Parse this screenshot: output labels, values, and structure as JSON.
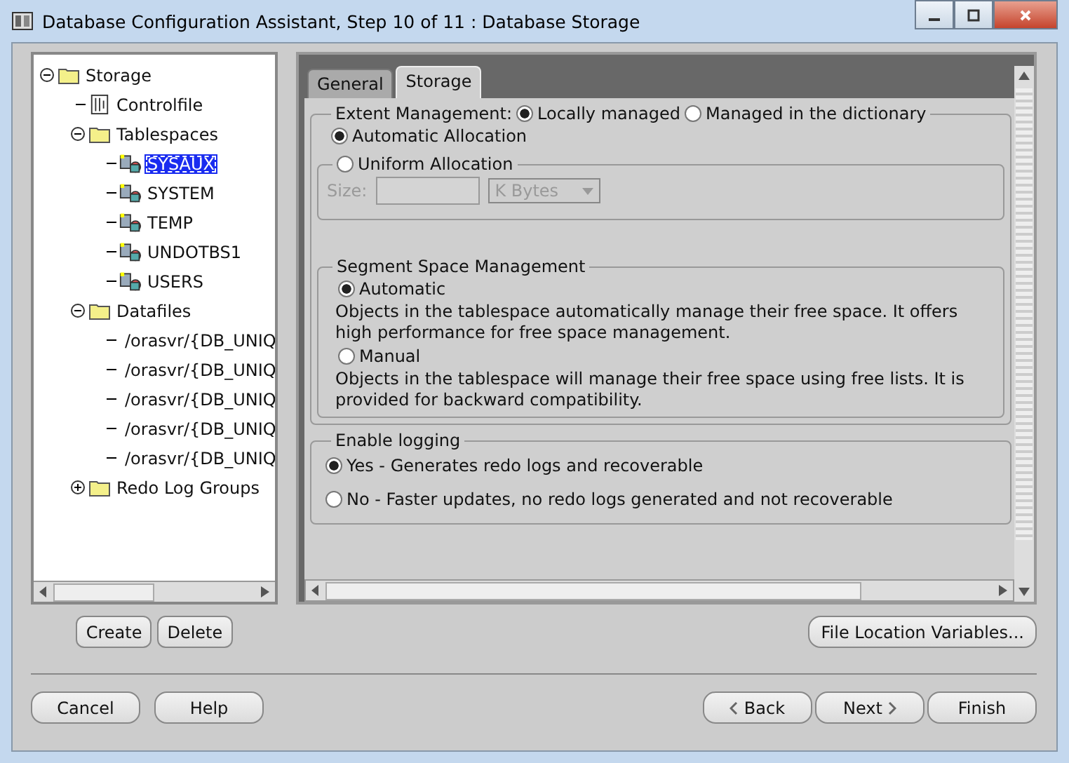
{
  "window": {
    "title": "Database Configuration Assistant, Step 10 of 11 : Database Storage"
  },
  "tree": [
    {
      "label": "Storage",
      "kind": "folder",
      "expanded": true,
      "selected": false,
      "children": [
        {
          "label": "Controlfile",
          "kind": "controlfile",
          "selected": false
        },
        {
          "label": "Tablespaces",
          "kind": "folder",
          "expanded": true,
          "selected": false,
          "children": [
            {
              "label": "SYSAUX",
              "kind": "tablespace",
              "selected": true
            },
            {
              "label": "SYSTEM",
              "kind": "tablespace",
              "selected": false
            },
            {
              "label": "TEMP",
              "kind": "tablespace",
              "selected": false
            },
            {
              "label": "UNDOTBS1",
              "kind": "tablespace",
              "selected": false
            },
            {
              "label": "USERS",
              "kind": "tablespace",
              "selected": false
            }
          ]
        },
        {
          "label": "Datafiles",
          "kind": "folder",
          "expanded": true,
          "selected": false,
          "children": [
            {
              "label": "/orasvr/{DB_UNIQ",
              "kind": "datafile",
              "selected": false
            },
            {
              "label": "/orasvr/{DB_UNIQ",
              "kind": "datafile",
              "selected": false
            },
            {
              "label": "/orasvr/{DB_UNIQ",
              "kind": "datafile",
              "selected": false
            },
            {
              "label": "/orasvr/{DB_UNIQ",
              "kind": "datafile",
              "selected": false
            },
            {
              "label": "/orasvr/{DB_UNIQ",
              "kind": "datafile",
              "selected": false
            }
          ]
        },
        {
          "label": "Redo Log Groups",
          "kind": "folder",
          "expanded": false,
          "selected": false
        }
      ]
    }
  ],
  "tree_buttons": [
    "Create",
    "Delete"
  ],
  "tabs": [
    {
      "label": "General",
      "selected": false
    },
    {
      "label": "Storage",
      "selected": true
    }
  ],
  "extent_management": {
    "label": "Extent Management:",
    "options": [
      {
        "label": "Locally managed",
        "selected": true
      },
      {
        "label": "Managed in the dictionary",
        "selected": false
      }
    ],
    "allocation": [
      {
        "label": "Automatic Allocation",
        "selected": true
      },
      {
        "label": "Uniform Allocation",
        "selected": false
      }
    ],
    "size_label": "Size:",
    "size_unit": "K Bytes",
    "size_disabled": true
  },
  "segment_space": {
    "title": "Segment Space Management",
    "options": [
      {
        "label": "Automatic",
        "selected": true,
        "description": "Objects in the tablespace automatically manage their free space. It offers high performance for free space management."
      },
      {
        "label": "Manual",
        "selected": false,
        "description": "Objects in the tablespace will manage their free space using free lists. It is provided for backward compatibility."
      }
    ]
  },
  "logging": {
    "title": "Enable logging",
    "options": [
      {
        "label": "Yes - Generates redo logs and recoverable",
        "selected": true
      },
      {
        "label": "No - Faster updates, no redo logs generated and not recoverable",
        "selected": false
      }
    ]
  },
  "file_location_button": "File Location Variables...",
  "left_buttons": [
    "Cancel",
    "Help"
  ],
  "nav_buttons": [
    {
      "label": "Back",
      "kind": "back"
    },
    {
      "label": "Next",
      "kind": "next"
    },
    {
      "label": "Finish",
      "kind": "finish"
    }
  ]
}
